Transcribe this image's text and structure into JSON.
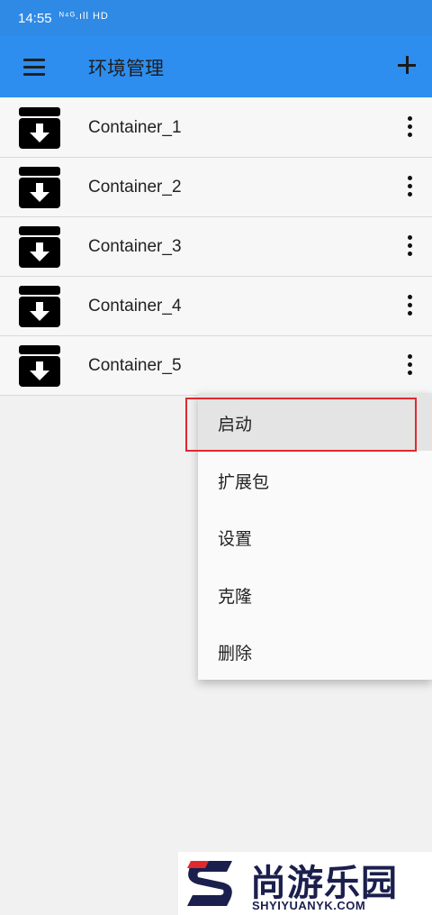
{
  "status_bar": {
    "time": "14:55",
    "indicators": "ᴺ⁴ᴳ.ıll HD"
  },
  "app_bar": {
    "title": "环境管理",
    "menu_icon": "hamburger-menu-icon",
    "add_icon": "plus-icon"
  },
  "containers": [
    {
      "name": "Container_1"
    },
    {
      "name": "Container_2"
    },
    {
      "name": "Container_3"
    },
    {
      "name": "Container_4"
    },
    {
      "name": "Container_5"
    }
  ],
  "context_menu": {
    "items": [
      {
        "label": "启动",
        "highlighted": true
      },
      {
        "label": "扩展包"
      },
      {
        "label": "设置"
      },
      {
        "label": "克隆"
      },
      {
        "label": "删除"
      }
    ]
  },
  "watermark": {
    "brand": "尚游乐园",
    "url": "SHYIYUANYK.COM"
  },
  "colors": {
    "app_bar": "#2d8ef0",
    "highlight_border": "#e0292f",
    "watermark_text": "#1b1f4d"
  }
}
